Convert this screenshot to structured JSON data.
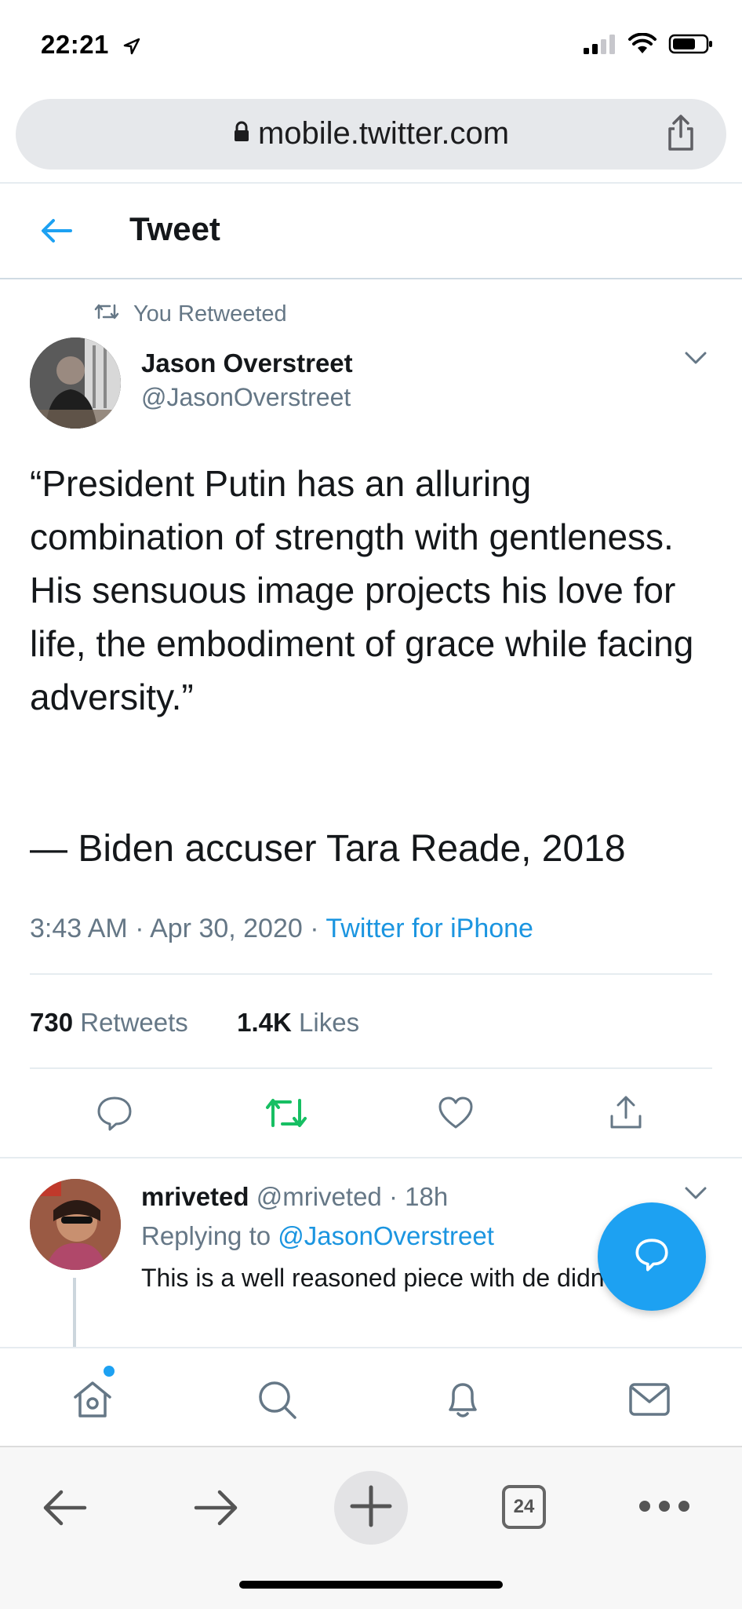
{
  "status_bar": {
    "time": "22:21"
  },
  "url_bar": {
    "url": "mobile.twitter.com"
  },
  "header": {
    "title": "Tweet"
  },
  "tweet": {
    "retweet_context": "You Retweeted",
    "author_name": "Jason Overstreet",
    "author_handle": "@JasonOverstreet",
    "text": "“President Putin has an alluring combination of strength with gentleness. His sensuous image projects his love for life, the embodiment of grace while facing adversity.”",
    "attribution": "— Biden accuser Tara Reade, 2018",
    "timestamp": "3:43 AM · Apr 30, 2020 · ",
    "source": "Twitter for iPhone",
    "retweets_count": "730",
    "retweets_label": " Retweets",
    "likes_count": "1.4K",
    "likes_label": " Likes"
  },
  "reply": {
    "name": "mriveted",
    "handle": "@mriveted",
    "time": " · 18h",
    "replying_prefix": "Replying to ",
    "replying_to": "@JasonOverstreet",
    "text": "This is a well reasoned piece with de didn’t know."
  },
  "safari": {
    "tab_count": "24"
  },
  "colors": {
    "accent": "#1da1f2",
    "retweet_active": "#17bf63",
    "muted": "#657786"
  }
}
